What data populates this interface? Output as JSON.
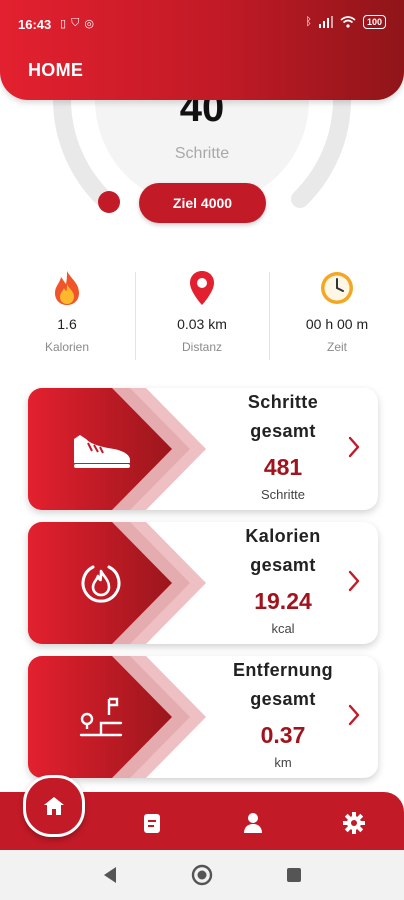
{
  "status_bar": {
    "time": "16:43",
    "left_icons": [
      "sim-icon",
      "shield-icon",
      "app-icon"
    ],
    "battery": "100"
  },
  "header": {
    "title": "HOME"
  },
  "gauge": {
    "value": "40",
    "unit": "Schritte",
    "goal_label": "Ziel 4000",
    "progress": 0.01
  },
  "stats": [
    {
      "icon": "flame-icon",
      "value": "1.6",
      "label": "Kalorien"
    },
    {
      "icon": "location-pin-icon",
      "value": "0.03 km",
      "label": "Distanz"
    },
    {
      "icon": "clock-icon",
      "value": "00 h 00 m",
      "label": "Zeit"
    }
  ],
  "cards": [
    {
      "icon": "sneaker-icon",
      "title_line1": "Schritte",
      "title_line2": "gesamt",
      "value": "481",
      "unit": "Schritte"
    },
    {
      "icon": "flame-circle-icon",
      "title_line1": "Kalorien",
      "title_line2": "gesamt",
      "value": "19.24",
      "unit": "kcal"
    },
    {
      "icon": "route-icon",
      "title_line1": "Entfernung",
      "title_line2": "gesamt",
      "value": "0.37",
      "unit": "km"
    }
  ],
  "bottom_nav": [
    "home-icon",
    "clipboard-icon",
    "person-icon",
    "settings-icon"
  ],
  "colors": {
    "primary": "#c31a27",
    "primary_dark": "#8f1519",
    "value": "#a1141d"
  }
}
